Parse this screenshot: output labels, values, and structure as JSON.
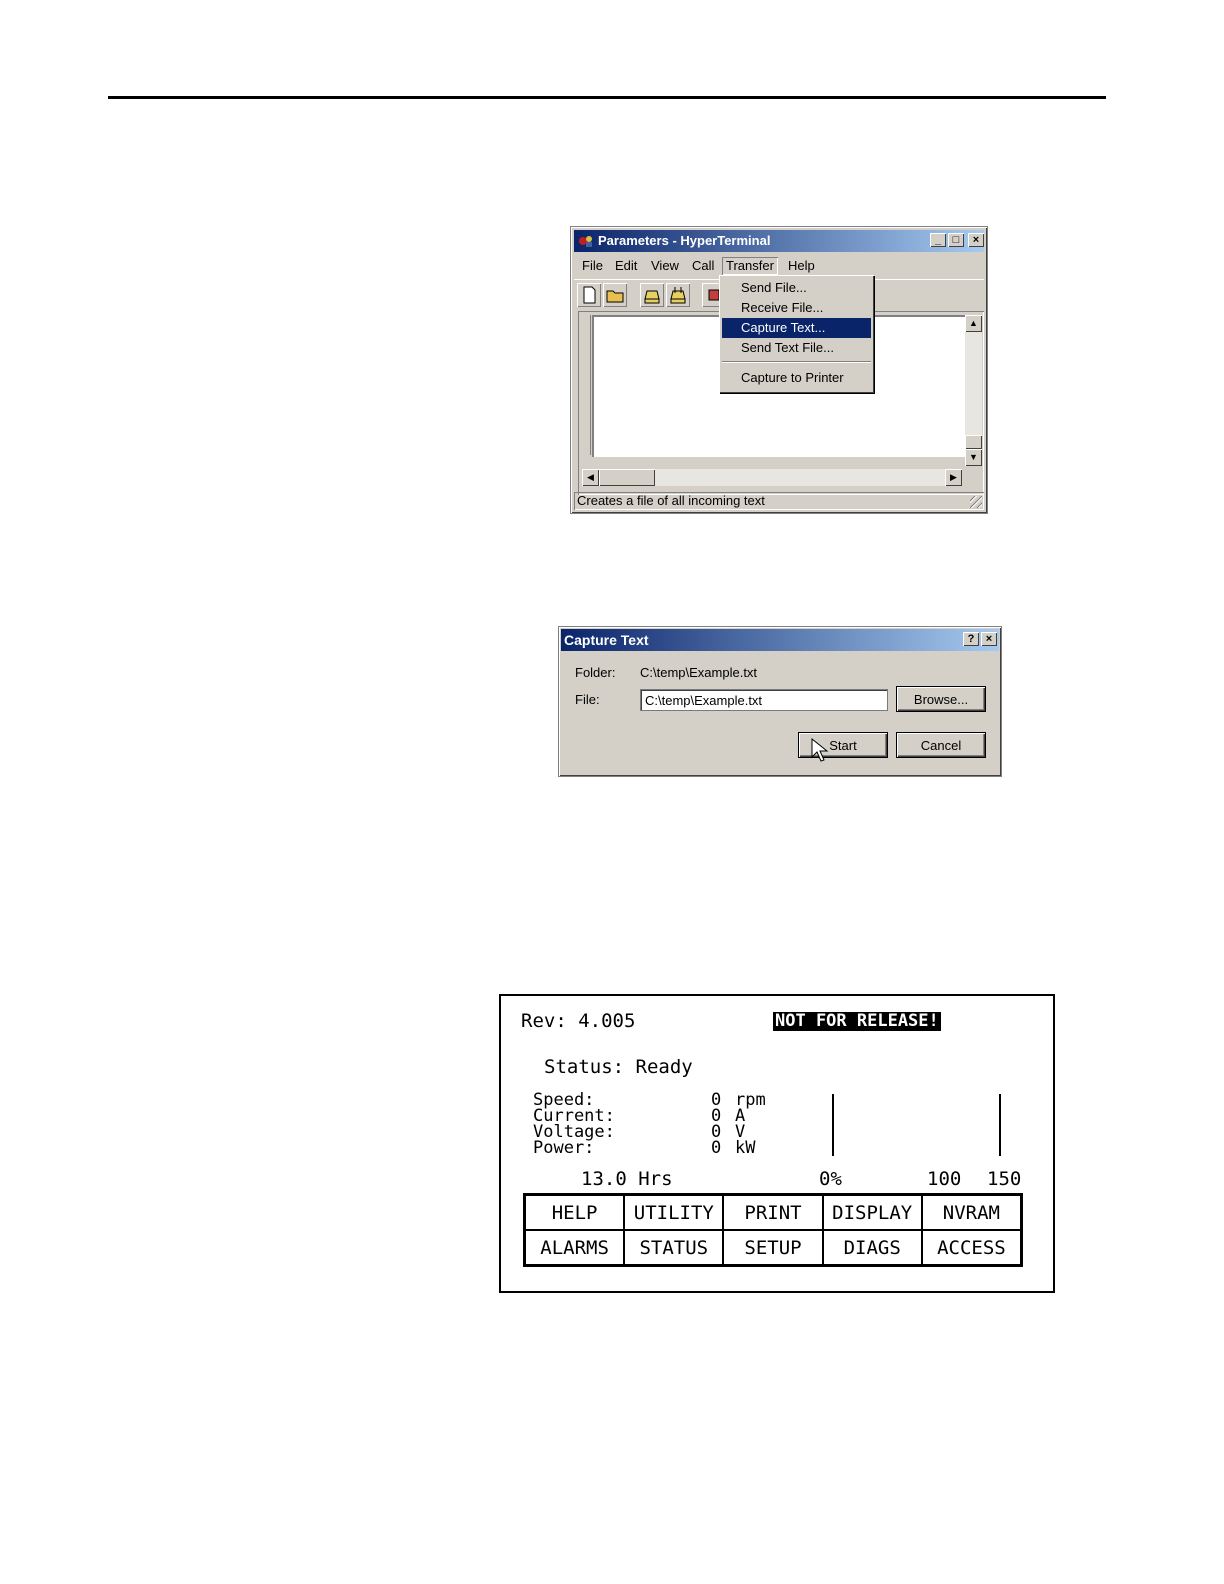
{
  "hyperterminal": {
    "title": "Parameters - HyperTerminal",
    "caption_buttons": {
      "minimize": "_",
      "maximize": "□",
      "close": "×"
    },
    "menu": [
      "File",
      "Edit",
      "View",
      "Call",
      "Transfer",
      "Help"
    ],
    "transfer_menu": [
      "Send File...",
      "Receive File...",
      "Capture Text...",
      "Send Text File...",
      "Capture to Printer"
    ],
    "highlighted_item": "Capture Text...",
    "status_text": "Creates a file of all incoming text"
  },
  "capture_dialog": {
    "title": "Capture Text",
    "help_button": "?",
    "close_button": "×",
    "folder_label": "Folder:",
    "folder_value": "C:\\temp\\Example.txt",
    "file_label": "File:",
    "file_value": "C:\\temp\\Example.txt",
    "browse_label": "Browse...",
    "start_label": "Start",
    "cancel_label": "Cancel"
  },
  "lcd": {
    "rev_label": "Rev: 4.005",
    "banner": "NOT FOR RELEASE!",
    "status_line": "Status: Ready",
    "readings": [
      {
        "label": "Speed:",
        "value": "0",
        "unit": "rpm"
      },
      {
        "label": "Current:",
        "value": "0",
        "unit": "A"
      },
      {
        "label": "Voltage:",
        "value": "0",
        "unit": "V"
      },
      {
        "label": "Power:",
        "value": "0",
        "unit": "kW"
      }
    ],
    "hours": "13.0 Hrs",
    "scale_0": "0%",
    "scale_100": "100",
    "scale_150": "150",
    "keys": [
      "HELP",
      "UTILITY",
      "PRINT",
      "DISPLAY",
      "NVRAM",
      "ALARMS",
      "STATUS",
      "SETUP",
      "DIAGS",
      "ACCESS"
    ]
  }
}
